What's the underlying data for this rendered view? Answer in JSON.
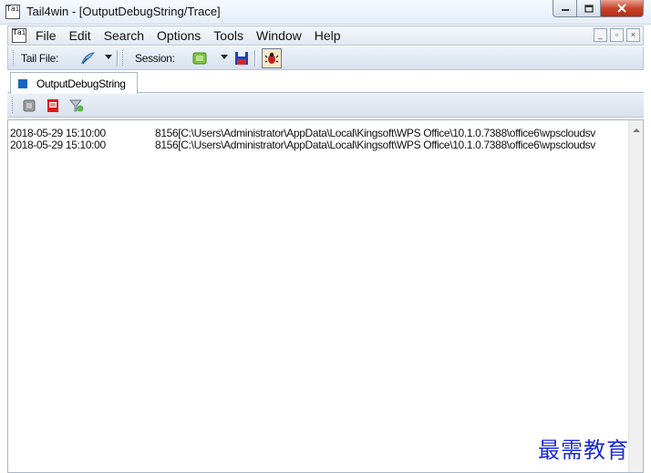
{
  "window": {
    "title": "Tail4win - [OutputDebugString/Trace]",
    "app_icon_text": "Tail"
  },
  "menu": {
    "items": [
      "File",
      "Edit",
      "Search",
      "Options",
      "Tools",
      "Window",
      "Help"
    ]
  },
  "mdi_buttons": {
    "minimize": "_",
    "restore": "▫",
    "close": "×"
  },
  "toolbar": {
    "tail_file_label": "Tail File:",
    "session_label": "Session:"
  },
  "tabs": [
    {
      "label": "OutputDebugString",
      "icon": "blue-square-icon",
      "color": "#1565c0"
    }
  ],
  "log": {
    "rows": [
      {
        "timestamp": "2018-05-29 15:10:00",
        "message": "8156[C:\\Users\\Administrator\\AppData\\Local\\Kingsoft\\WPS Office\\10.1.0.7388\\office6\\wpscloudsv"
      },
      {
        "timestamp": "2018-05-29 15:10:00",
        "message": "8156[C:\\Users\\Administrator\\AppData\\Local\\Kingsoft\\WPS Office\\10.1.0.7388\\office6\\wpscloudsv"
      }
    ]
  },
  "watermark": "最需教育",
  "colors": {
    "close_button": "#c7452c",
    "tab_icon": "#1565c0",
    "watermark": "#1a2bd6"
  }
}
